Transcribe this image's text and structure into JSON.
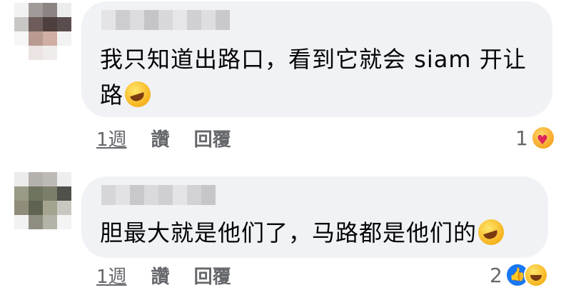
{
  "comments": [
    {
      "text": "我只知道出路口，看到它就会 siam 开让路",
      "emoji": "rolling-on-floor-laughing",
      "time": "1週",
      "like_label": "讚",
      "reply_label": "回覆",
      "reaction_count": "1",
      "reaction_icons": [
        "care-hug"
      ]
    },
    {
      "text": "胆最大就是他们了，马路都是他们的",
      "emoji": "rolling-on-floor-laughing",
      "time": "1週",
      "like_label": "讚",
      "reply_label": "回覆",
      "reaction_count": "2",
      "reaction_icons": [
        "like-thumb",
        "haha-face"
      ]
    }
  ],
  "colors": {
    "bubble": "#f0f2f5",
    "text": "#050505",
    "meta": "#65676b",
    "like_blue": "#1877f2"
  }
}
